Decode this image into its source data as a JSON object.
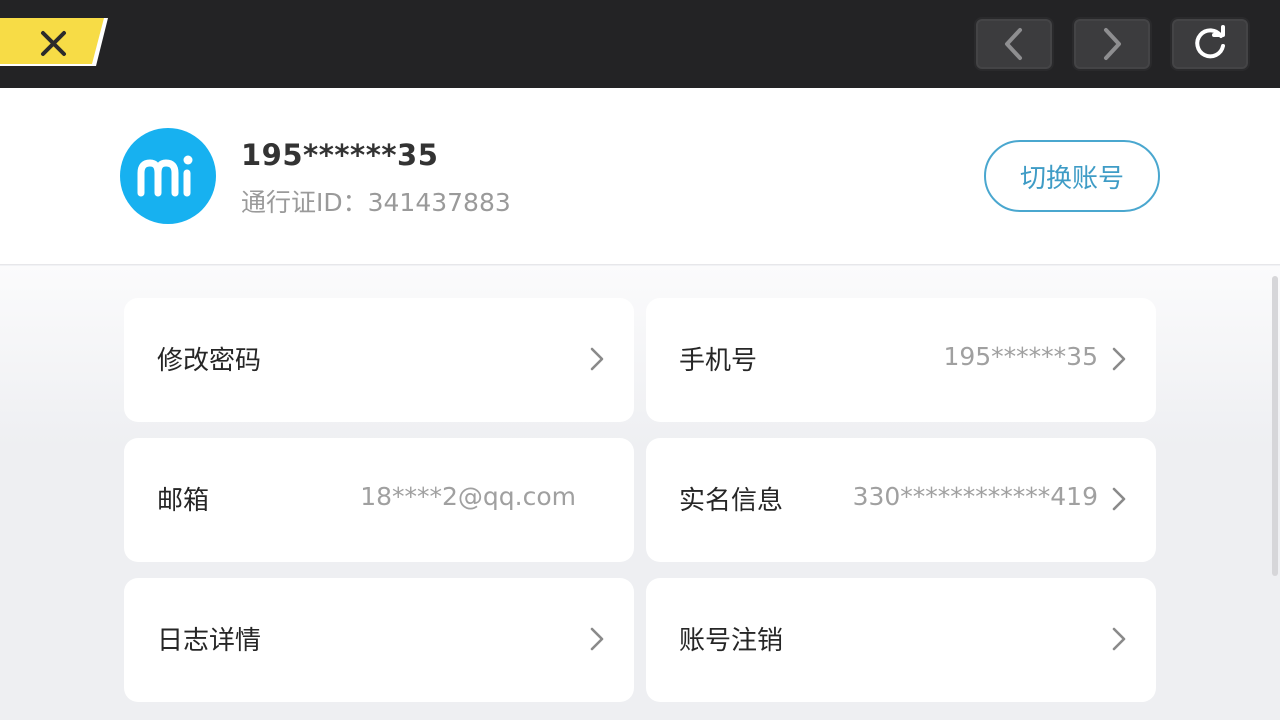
{
  "toolbar": {
    "close_icon": "close-icon",
    "back_icon": "chevron-left-icon",
    "forward_icon": "chevron-right-icon",
    "refresh_icon": "refresh-icon",
    "accent_color": "#f7dc46"
  },
  "account": {
    "avatar_icon": "mi-logo",
    "username": "195******35",
    "passport_id": "通行证ID：341437883",
    "switch_label": "切换账号",
    "avatar_color": "#17b1f0"
  },
  "items": [
    {
      "label": "修改密码",
      "value": "",
      "arrow": true
    },
    {
      "label": "手机号",
      "value": "195******35",
      "arrow": true
    },
    {
      "label": "邮箱",
      "value": "18****2@qq.com",
      "arrow": false
    },
    {
      "label": "实名信息",
      "value": "330************419",
      "arrow": true
    },
    {
      "label": "日志详情",
      "value": "",
      "arrow": true
    },
    {
      "label": "账号注销",
      "value": "",
      "arrow": true
    }
  ]
}
